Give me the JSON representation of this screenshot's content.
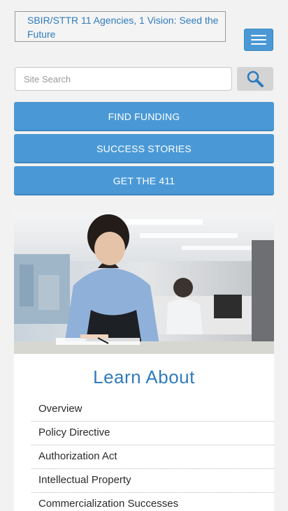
{
  "header": {
    "site_title": "SBIR/STTR 11 Agencies, 1 Vision: Seed the Future",
    "menu_icon": "hamburger-menu-icon"
  },
  "search": {
    "placeholder": "Site Search",
    "button_icon": "magnifier-icon"
  },
  "nav_buttons": [
    {
      "label": "FIND FUNDING"
    },
    {
      "label": "SUCCESS STORIES"
    },
    {
      "label": "GET THE 411"
    }
  ],
  "learn_about": {
    "title": "Learn About",
    "items": [
      {
        "label": "Overview"
      },
      {
        "label": "Policy Directive"
      },
      {
        "label": "Authorization Act"
      },
      {
        "label": "Intellectual Property"
      },
      {
        "label": "Commercialization Successes"
      }
    ]
  },
  "colors": {
    "accent": "#4a99d6",
    "link_blue": "#2f7bbd",
    "page_bg": "#f2f2f2"
  }
}
